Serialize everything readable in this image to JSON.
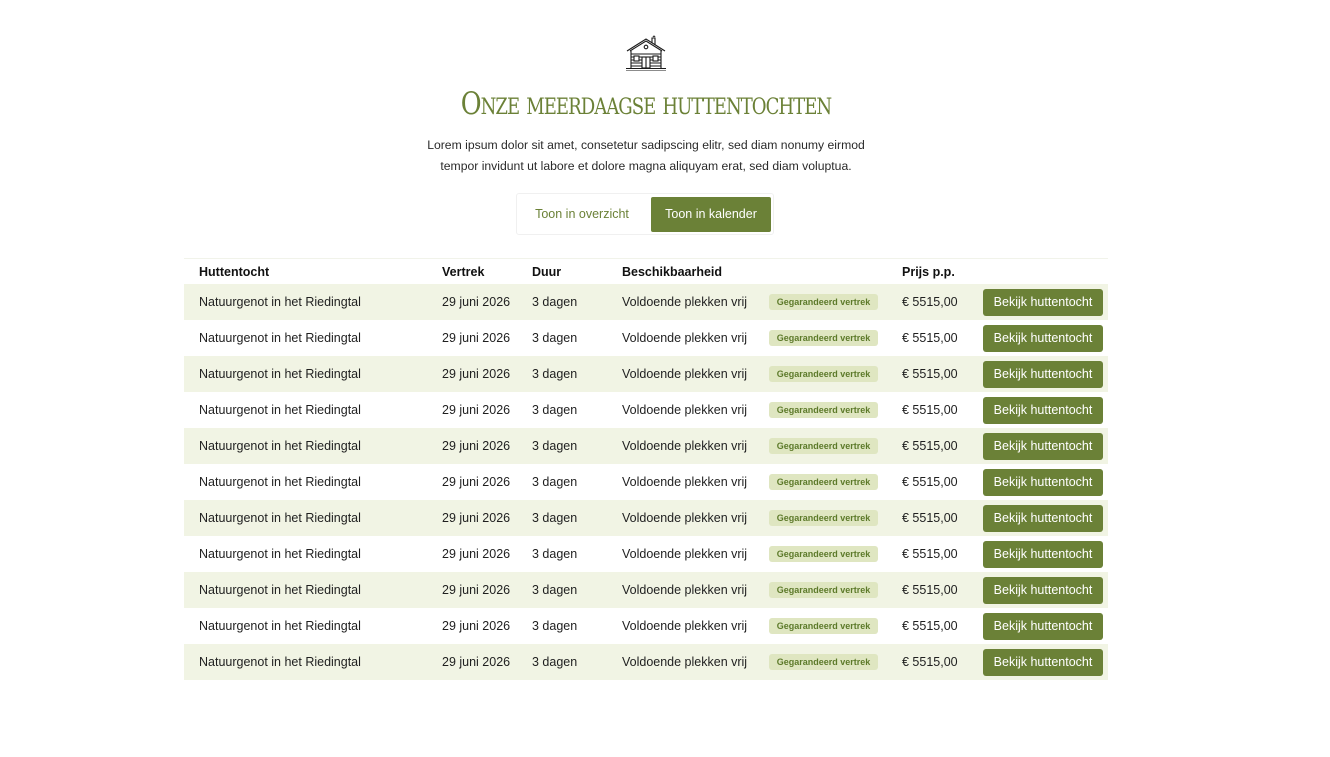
{
  "header": {
    "icon": "hut-icon",
    "title": "Onze meerdaagse huttentochten",
    "intro_line1": "Lorem ipsum dolor sit amet, consetetur sadipscing elitr, sed diam nonumy eirmod",
    "intro_line2": "tempor invidunt ut labore et dolore magna aliquyam erat, sed diam voluptua."
  },
  "toggle": {
    "overview_label": "Toon in overzicht",
    "calendar_label": "Toon in kalender",
    "active": "calendar"
  },
  "colors": {
    "accent": "#6b8137",
    "row_alt": "#f1f4e4",
    "badge_bg": "#dfe6c1",
    "badge_text": "#5d7a2a"
  },
  "table": {
    "columns": [
      "Huttentocht",
      "Vertrek",
      "Duur",
      "Beschikbaarheid",
      "Prijs p.p."
    ],
    "rows": [
      {
        "name": "Natuurgenot in het Riedingtal",
        "departure": "29 juni 2026",
        "duration": "3 dagen",
        "availability": "Voldoende plekken vrij",
        "badge": "Gegarandeerd vertrek",
        "price": "€ 5515,00",
        "button": "Bekijk huttentocht"
      },
      {
        "name": "Natuurgenot in het Riedingtal",
        "departure": "29 juni 2026",
        "duration": "3 dagen",
        "availability": "Voldoende plekken vrij",
        "badge": "Gegarandeerd vertrek",
        "price": "€ 5515,00",
        "button": "Bekijk huttentocht"
      },
      {
        "name": "Natuurgenot in het Riedingtal",
        "departure": "29 juni 2026",
        "duration": "3 dagen",
        "availability": "Voldoende plekken vrij",
        "badge": "Gegarandeerd vertrek",
        "price": "€ 5515,00",
        "button": "Bekijk huttentocht"
      },
      {
        "name": "Natuurgenot in het Riedingtal",
        "departure": "29 juni 2026",
        "duration": "3 dagen",
        "availability": "Voldoende plekken vrij",
        "badge": "Gegarandeerd vertrek",
        "price": "€ 5515,00",
        "button": "Bekijk huttentocht"
      },
      {
        "name": "Natuurgenot in het Riedingtal",
        "departure": "29 juni 2026",
        "duration": "3 dagen",
        "availability": "Voldoende plekken vrij",
        "badge": "Gegarandeerd vertrek",
        "price": "€ 5515,00",
        "button": "Bekijk huttentocht"
      },
      {
        "name": "Natuurgenot in het Riedingtal",
        "departure": "29 juni 2026",
        "duration": "3 dagen",
        "availability": "Voldoende plekken vrij",
        "badge": "Gegarandeerd vertrek",
        "price": "€ 5515,00",
        "button": "Bekijk huttentocht"
      },
      {
        "name": "Natuurgenot in het Riedingtal",
        "departure": "29 juni 2026",
        "duration": "3 dagen",
        "availability": "Voldoende plekken vrij",
        "badge": "Gegarandeerd vertrek",
        "price": "€ 5515,00",
        "button": "Bekijk huttentocht"
      },
      {
        "name": "Natuurgenot in het Riedingtal",
        "departure": "29 juni 2026",
        "duration": "3 dagen",
        "availability": "Voldoende plekken vrij",
        "badge": "Gegarandeerd vertrek",
        "price": "€ 5515,00",
        "button": "Bekijk huttentocht"
      },
      {
        "name": "Natuurgenot in het Riedingtal",
        "departure": "29 juni 2026",
        "duration": "3 dagen",
        "availability": "Voldoende plekken vrij",
        "badge": "Gegarandeerd vertrek",
        "price": "€ 5515,00",
        "button": "Bekijk huttentocht"
      },
      {
        "name": "Natuurgenot in het Riedingtal",
        "departure": "29 juni 2026",
        "duration": "3 dagen",
        "availability": "Voldoende plekken vrij",
        "badge": "Gegarandeerd vertrek",
        "price": "€ 5515,00",
        "button": "Bekijk huttentocht"
      },
      {
        "name": "Natuurgenot in het Riedingtal",
        "departure": "29 juni 2026",
        "duration": "3 dagen",
        "availability": "Voldoende plekken vrij",
        "badge": "Gegarandeerd vertrek",
        "price": "€ 5515,00",
        "button": "Bekijk huttentocht"
      }
    ]
  }
}
